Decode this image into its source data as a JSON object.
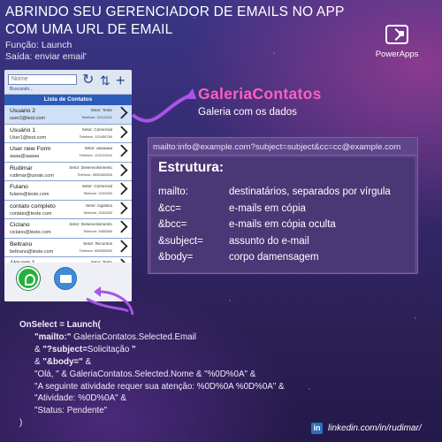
{
  "header": {
    "line1": "ABRINDO SEU GERENCIADOR DE EMAILS NO APP",
    "line2": "COM UMA URL DE EMAIL",
    "funcao": "Função: Launch",
    "saida": "Saída: enviar email'"
  },
  "powerapps": {
    "label": "PowerApps",
    "icon": "powerapps-logo-icon"
  },
  "phone": {
    "search_placeholder": "Nome",
    "search_hint": "Buscando...",
    "list_title": "Lista de Contatos",
    "rows": [
      {
        "name": "Usuario 2",
        "email": "user2@test.com",
        "sector": "Setor: Teste",
        "phone": "Telefone: 111111111",
        "selected": true
      },
      {
        "name": "Usuário 1",
        "email": "User1@test.com",
        "sector": "Setor: Comercial",
        "phone": "Telefone: 123456789"
      },
      {
        "name": "User new Form",
        "email": "aaaa@aaaaa",
        "sector": "Setor: aaaaaaa",
        "phone": "Telefone: 123123242"
      },
      {
        "name": "Rudimar",
        "email": "rudimar@uorak.com",
        "sector": "Setor: Desenvolvimento",
        "phone": "Telefone: 5555555555"
      },
      {
        "name": "Fulano",
        "email": "fulano@teste.com",
        "sector": "Setor: Comercial",
        "phone": "Telefone: 3333333"
      },
      {
        "name": "contato completo",
        "email": "contato@teste.com",
        "sector": "Setor: logistica",
        "phone": "Telefone: 3333333"
      },
      {
        "name": "Ciclano",
        "email": "ciclano@teste.com",
        "sector": "Setor: Desenvolvimento",
        "phone": "Telefone: 5555555"
      },
      {
        "name": "Beltrano",
        "email": "beltrano@teste.com",
        "sector": "Setor: Recursos",
        "phone": "Telefone: 555555555"
      },
      {
        "name": "Alguem 1",
        "email": "",
        "sector": "Setor: Teste",
        "phone": ""
      }
    ]
  },
  "callout": {
    "title": "GaleriaContatos",
    "subtitle": "Galeria com os dados"
  },
  "box": {
    "url": "mailto:info@example.com?subject=subject&cc=cc@example.com",
    "heading": "Estrutura:",
    "items": [
      {
        "key": "mailto:",
        "desc": "destinatários, separados por vírgula"
      },
      {
        "key": "&cc=",
        "desc": "e-mails em cópia"
      },
      {
        "key": "&bcc=",
        "desc": "e-mails em cópia oculta"
      },
      {
        "key": "&subject=",
        "desc": "assunto do e-mail"
      },
      {
        "key": "&body=",
        "desc": "corpo damensagem"
      }
    ]
  },
  "code": {
    "l1": "OnSelect = Launch(",
    "l2a": "\"mailto:\"",
    "l2b": " GaleriaContatos.Selected.Email",
    "l3a": "& ",
    "l3b": "\"?subject=",
    "l3c": "Solicitação",
    "l3d": " \"",
    "l4a": "& ",
    "l4b": "\"&body=\"",
    "l4c": " &",
    "l5": "\"Olá, \" & GaleriaContatos.Selected.Nome & \"%0D%0A\" &",
    "l6": " \"A seguinte atividade requer sua atenção: %0D%0A %0D%0A\" &",
    "l7": "\"Atividade:  %0D%0A\" &",
    "l8": "\"Status: Pendente\"",
    "l9": ")"
  },
  "footer": {
    "linkedin": "linkedin.com/in/rudimar/"
  },
  "colors": {
    "accent_pink": "#ff5fc0",
    "box_purple": "#5f468a",
    "arrow": "#a855e8"
  }
}
